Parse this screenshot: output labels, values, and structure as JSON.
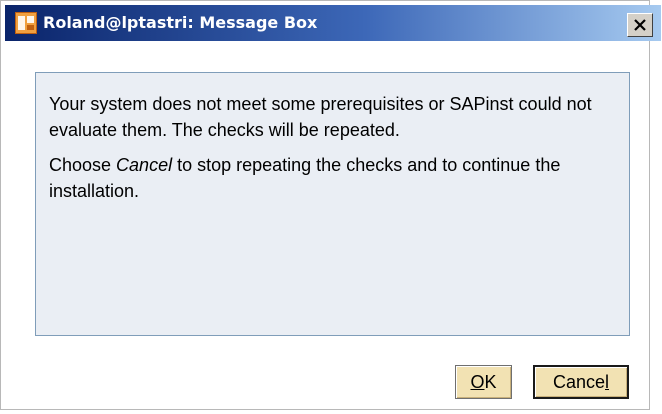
{
  "window": {
    "title": "Roland@lptastri: Message Box",
    "app_icon": "sap-installer-icon",
    "close_icon": "close-icon"
  },
  "message": {
    "paragraph1": "Your system does not meet some prerequisites or SAPinst could not evaluate them. The checks will be repeated.",
    "paragraph2_prefix": "Choose ",
    "paragraph2_emphasis": "Cancel",
    "paragraph2_suffix": " to stop repeating the checks and to continue the installation."
  },
  "buttons": {
    "ok_mnemonic": "O",
    "ok_rest": "K",
    "cancel_prefix": "Cance",
    "cancel_mnemonic": "l"
  },
  "colors": {
    "titlebar_start": "#0a246a",
    "titlebar_end": "#a6caf0",
    "panel_background": "#eaeef4",
    "button_background": "#f2e2b3"
  }
}
